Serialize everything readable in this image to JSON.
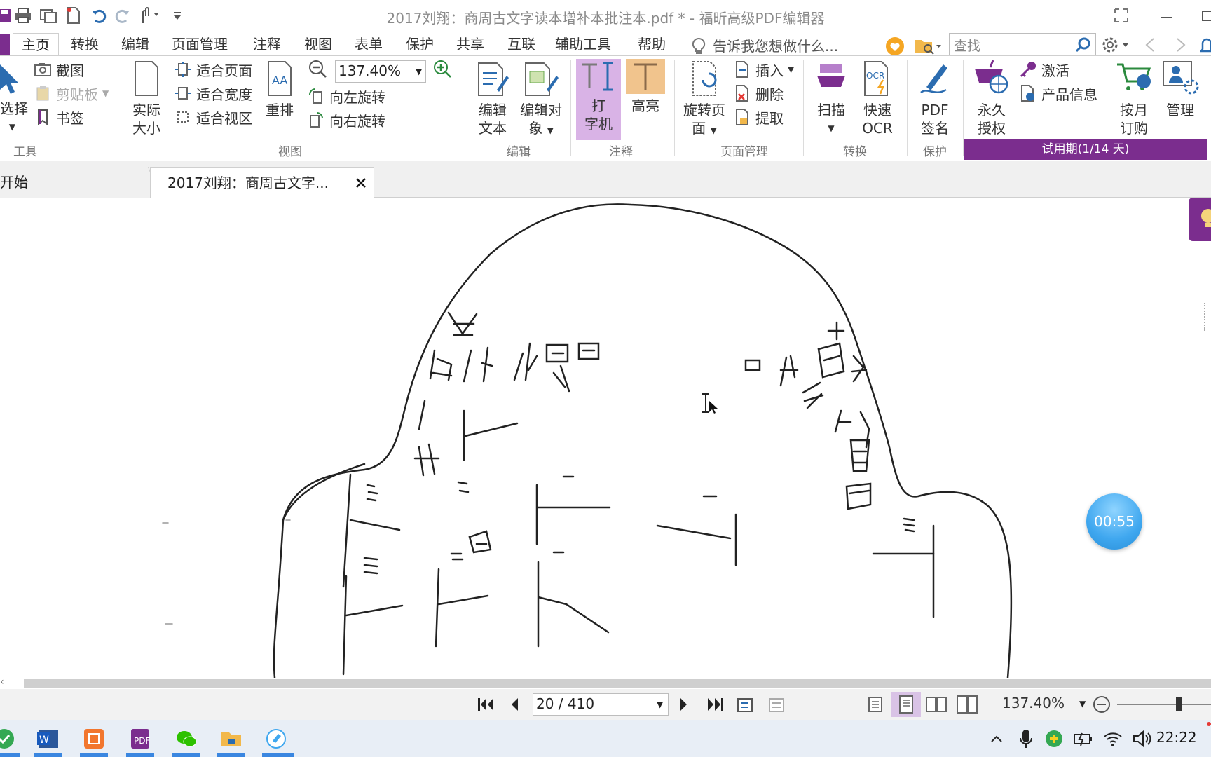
{
  "window": {
    "title": "2017刘翔：商周古文字读本增补本批注本.pdf * - 福昕高级PDF编辑器"
  },
  "menu": {
    "items": [
      "主页",
      "转换",
      "编辑",
      "页面管理",
      "注释",
      "视图",
      "表单",
      "保护",
      "共享",
      "互联",
      "辅助工具",
      "帮助"
    ],
    "tell_me": "告诉我您想做什么...",
    "search_placeholder": "查找"
  },
  "ribbon": {
    "tools": {
      "select": "选择",
      "screenshot": "截图",
      "clipboard": "剪贴板",
      "bookmark": "书签",
      "group": "工具"
    },
    "view": {
      "actual_size_1": "实际",
      "actual_size_2": "大小",
      "fit_page": "适合页面",
      "fit_width": "适合宽度",
      "fit_view": "适合视区",
      "reflow": "重排",
      "zoom": "137.40%",
      "rotate_left": "向左旋转",
      "rotate_right": "向右旋转",
      "group": "视图"
    },
    "edit": {
      "edit_text_1": "编辑",
      "edit_text_2": "文本",
      "edit_object_1": "编辑对",
      "edit_object_2": "象",
      "group": "编辑"
    },
    "annot": {
      "typewriter_1": "打",
      "typewriter_2": "字机",
      "highlight": "高亮",
      "group": "注释"
    },
    "pages": {
      "rotate_page_1": "旋转页",
      "rotate_page_2": "面",
      "insert": "插入",
      "delete": "删除",
      "extract": "提取",
      "group": "页面管理"
    },
    "convert": {
      "scan": "扫描",
      "ocr_1": "快速",
      "ocr_2": "OCR",
      "group": "转换"
    },
    "protect": {
      "sign_1": "PDF",
      "sign_2": "签名",
      "group": "保护"
    },
    "license": {
      "perm_1": "永久",
      "perm_2": "授权",
      "activate": "激活",
      "product_info": "产品信息",
      "monthly_1": "按月",
      "monthly_2": "订购",
      "manage": "管理",
      "trial": "试用期(1/14 天)"
    }
  },
  "tabs": {
    "start": "开始",
    "doc": "2017刘翔：商周古文字..."
  },
  "timer": "00:55",
  "status": {
    "page": "20 / 410",
    "zoom": "137.40%"
  },
  "taskbar": {
    "time": "22:22"
  },
  "colors": {
    "accent": "#7b2d8e",
    "trial_bg": "#7b2d8e",
    "typewriter_bg": "#d9b3e6",
    "highlight_bg": "#f1c48d",
    "timer": "#3fa7ef"
  }
}
